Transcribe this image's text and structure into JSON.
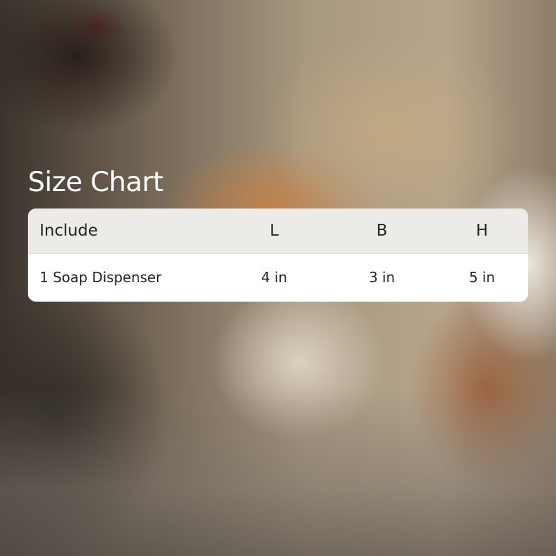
{
  "title": "Size Chart",
  "table": {
    "headers": [
      "Include",
      "L",
      "B",
      "H"
    ],
    "rows": [
      [
        "1 Soap Dispenser",
        "4 in",
        "3 in",
        "5 in"
      ]
    ]
  },
  "colors": {
    "title_text": "#ffffff",
    "header_background": "#edebe7",
    "row_background": "#ffffff",
    "table_text": "#222222"
  }
}
